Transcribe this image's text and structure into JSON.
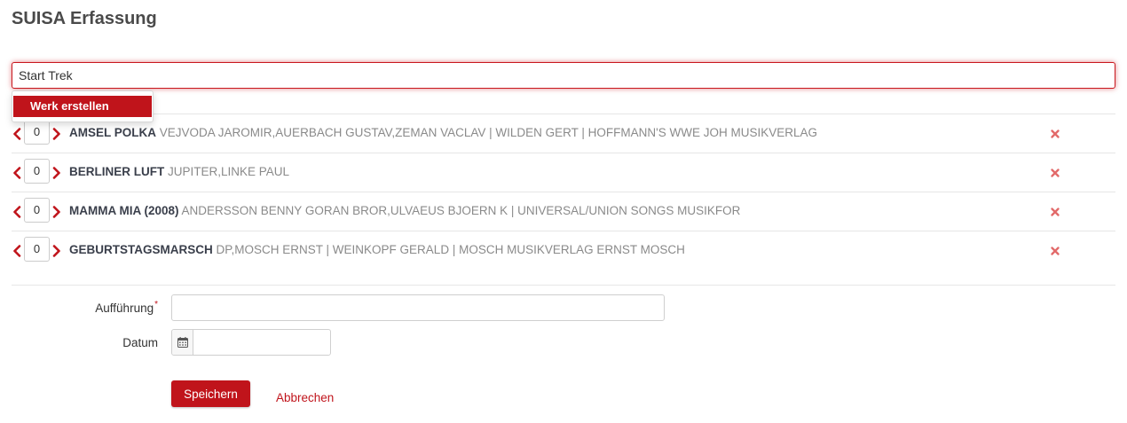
{
  "page": {
    "title": "SUISA Erfassung"
  },
  "search": {
    "value": "Start Trek"
  },
  "dropdown": {
    "create_label": "Werk erstellen"
  },
  "works": [
    {
      "count": "0",
      "title": "AMSEL POLKA",
      "meta": "VEJVODA JAROMIR,AUERBACH GUSTAV,ZEMAN VACLAV | WILDEN GERT | HOFFMANN'S WWE JOH MUSIKVERLAG"
    },
    {
      "count": "0",
      "title": "BERLINER LUFT",
      "meta": "JUPITER,LINKE PAUL"
    },
    {
      "count": "0",
      "title": "MAMMA MIA (2008)",
      "meta": "ANDERSSON BENNY GORAN BROR,ULVAEUS BJOERN K | UNIVERSAL/UNION SONGS MUSIKFOR"
    },
    {
      "count": "0",
      "title": "GEBURTSTAGSMARSCH",
      "meta": "DP,MOSCH ERNST | WEINKOPF GERALD | MOSCH MUSIKVERLAG ERNST MOSCH"
    }
  ],
  "form": {
    "performance_label": "Aufführung",
    "performance_required_mark": "*",
    "performance_value": "",
    "date_label": "Datum",
    "date_value": ""
  },
  "actions": {
    "save_label": "Speichern",
    "cancel_label": "Abbrechen"
  },
  "icons": {
    "decrement": "chevron-left-icon",
    "increment": "chevron-right-icon",
    "remove": "close-icon",
    "calendar": "calendar-icon"
  },
  "colors": {
    "accent": "#c0141b",
    "remove": "#e26a6a"
  }
}
